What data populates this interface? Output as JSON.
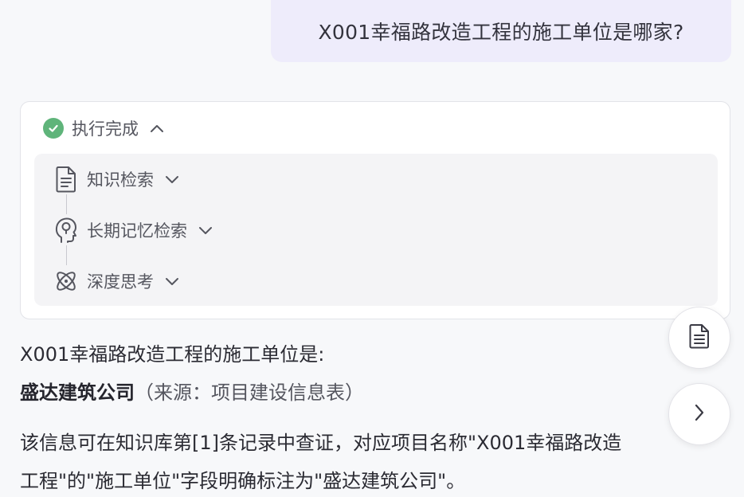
{
  "user_message": {
    "text": "X001幸福路改造工程的施工单位是哪家?"
  },
  "execution": {
    "status_label": "执行完成",
    "steps": [
      {
        "label": "知识检索",
        "icon": "document-icon"
      },
      {
        "label": "长期记忆检索",
        "icon": "brain-head-icon"
      },
      {
        "label": "深度思考",
        "icon": "atom-icon"
      }
    ]
  },
  "answer": {
    "line1": "X001幸福路改造工程的施工单位是:",
    "company": "盛达建筑公司",
    "source": "（来源：项目建设信息表）",
    "detail_line1": "该信息可在知识库第[1]条记录中查证，对应项目名称\"X001幸福路改造",
    "detail_line2": "工程\"的\"施工单位\"字段明确标注为\"盛达建筑公司\"。"
  },
  "side_buttons": [
    {
      "icon": "document-icon"
    },
    {
      "icon": "chevron-right-icon"
    }
  ]
}
